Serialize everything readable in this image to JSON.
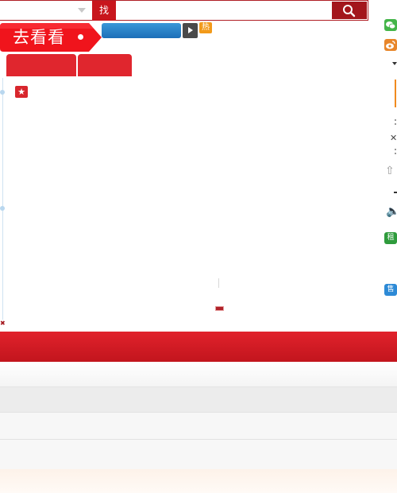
{
  "search": {
    "find_label": "找",
    "input_value": "",
    "input_placeholder": ""
  },
  "brand": {
    "tag_text": "去看看"
  },
  "badges": {
    "hot": "热",
    "rent": "租",
    "sell": "售"
  },
  "icons": {
    "search": "search-icon",
    "star": "star-icon",
    "wechat": "wechat-icon",
    "weibo": "weibo-icon",
    "play": "play-icon",
    "close": "close-icon",
    "up": "arrow-up-icon",
    "speaker": "speaker-icon"
  },
  "colors": {
    "brand_red": "#c8161d",
    "tab_red": "#e0262e",
    "blue": "#1c6fb8",
    "hot_orange": "#f29a1a",
    "rent_green": "#2e9b3c",
    "sell_blue": "#2d8ad6"
  }
}
